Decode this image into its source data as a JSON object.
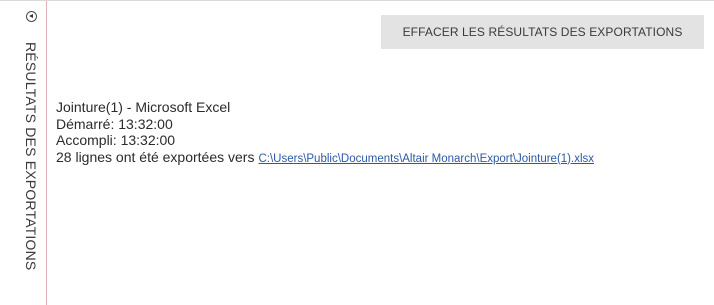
{
  "side_panel": {
    "title": "RÉSULTATS DES EXPORTATIONS",
    "collapse_icon": "collapse-left-icon"
  },
  "toolbar": {
    "clear_results_label": "EFFACER LES RÉSULTATS DES EXPORTATIONS"
  },
  "export_result": {
    "name": "Jointure(1) - Microsoft Excel",
    "started": "Démarré: 13:32:00",
    "completed": "Accompli: 13:32:00",
    "rows_text": "28 lignes ont été exportées vers",
    "path": "C:\\Users\\Public\\Documents\\Altair Monarch\\Export\\Jointure(1).xlsx"
  },
  "colors": {
    "divider_accent": "#e6b0b6",
    "button_bg": "#e3e3e3",
    "link": "#2a5aa8"
  }
}
